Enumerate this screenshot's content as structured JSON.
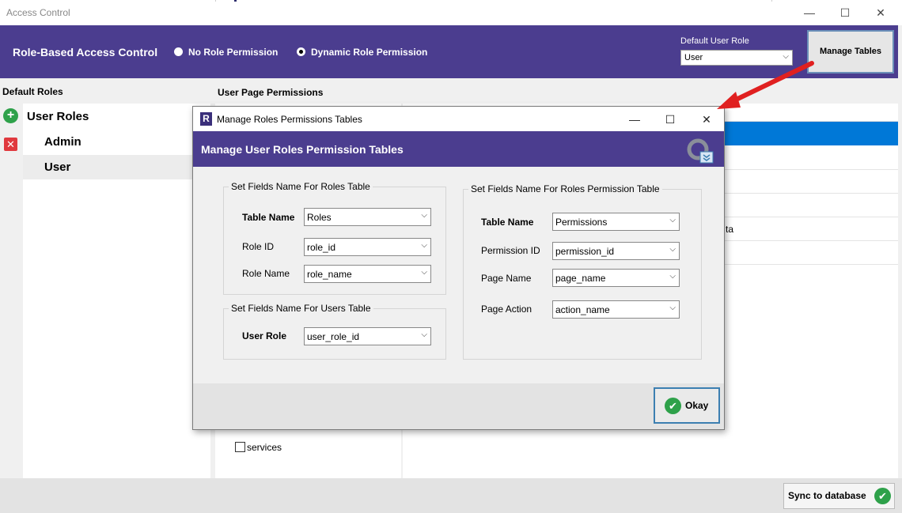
{
  "window": {
    "title": "Access Control",
    "minimize_glyph": "—",
    "maximize_glyph": "☐",
    "close_glyph": "✕"
  },
  "header": {
    "title": "Role-Based Access Control",
    "radio_options": [
      {
        "label": "No Role Permission",
        "selected": false
      },
      {
        "label": "Dynamic Role Permission",
        "selected": true
      }
    ],
    "default_user_role_label": "Default User Role",
    "default_user_role_value": "User",
    "manage_tables_label": "Manage Tables"
  },
  "left": {
    "heading": "Default Roles",
    "add_glyph": "+",
    "delete_glyph": "✕",
    "root_label": "User Roles",
    "roles": [
      "Admin",
      "User"
    ],
    "selected_role": "User"
  },
  "middle": {
    "heading": "User Page Permissions",
    "visible_page": {
      "label": "services",
      "checked": false
    }
  },
  "right": {
    "fragment_text": "ta"
  },
  "bottom": {
    "sync_label": "Sync to database",
    "sync_glyph": "✔"
  },
  "dialog": {
    "title": "Manage Roles Permissions Tables",
    "logo_letter": "R",
    "header": "Manage User Roles Permission Tables",
    "roles_table": {
      "legend": "Set Fields Name For Roles Table",
      "fields": [
        {
          "label": "Table Name",
          "value": "Roles",
          "bold": true
        },
        {
          "label": "Role ID",
          "value": "role_id",
          "bold": false
        },
        {
          "label": "Role Name",
          "value": "role_name",
          "bold": false
        }
      ]
    },
    "users_table": {
      "legend": "Set Fields Name For Users Table",
      "fields": [
        {
          "label": "User Role",
          "value": "user_role_id",
          "bold": true
        }
      ]
    },
    "permission_table": {
      "legend": "Set Fields Name For Roles Permission Table",
      "fields": [
        {
          "label": "Table Name",
          "value": "Permissions",
          "bold": true
        },
        {
          "label": "Permission ID",
          "value": "permission_id",
          "bold": false
        },
        {
          "label": "Page Name",
          "value": "page_name",
          "bold": false
        },
        {
          "label": "Page Action",
          "value": "action_name",
          "bold": false
        }
      ]
    },
    "okay_label": "Okay",
    "okay_glyph": "✔",
    "chevron_glyph": "⌵"
  },
  "colors": {
    "accent_purple": "#4b3d8f",
    "selection_blue": "#0078d7",
    "success_green": "#2ea14a",
    "danger_red": "#e0393e",
    "annotation_arrow": "#e02020"
  }
}
